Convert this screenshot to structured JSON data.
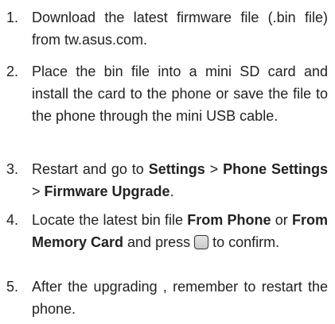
{
  "steps": [
    {
      "number": "1.",
      "text": "Download the latest firmware file (.bin file) from tw.asus.com."
    },
    {
      "number": "2.",
      "text": "Place the bin file into a  mini SD card and install the card to the phone or save the file to the phone through the mini USB cable."
    },
    {
      "number": "3.",
      "pre": "Restart and go to ",
      "b1": "Settings",
      "sep1": " > ",
      "b2": "Phone Settings",
      "sep2": " > ",
      "b3": "Firmware Upgrade",
      "post": "."
    },
    {
      "number": "4.",
      "pre": "Locate the latest bin file ",
      "b1": "From Phone",
      "mid": " or ",
      "b2": "From Memory Card",
      "pre_key": " and press ",
      "key_icon": "ok-key-icon",
      "post": " to confirm."
    },
    {
      "number": "5.",
      "text": "After the upgrading , remember to restart the phone."
    }
  ]
}
